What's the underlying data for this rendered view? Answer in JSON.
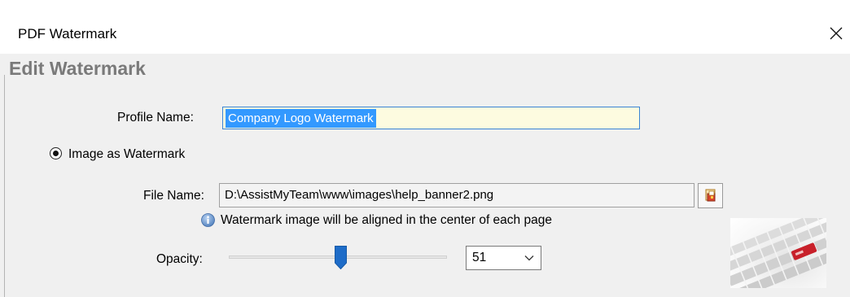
{
  "window": {
    "title": "PDF Watermark",
    "close_icon": "close-icon"
  },
  "heading": "Edit Watermark",
  "profile": {
    "label": "Profile Name:",
    "value": "Company Logo Watermark"
  },
  "watermark_type": {
    "image_option_label": "Image as Watermark",
    "image_option_selected": true
  },
  "file": {
    "label": "File Name:",
    "value": "D:\\AssistMyTeam\\www\\images\\help_banner2.png",
    "browse_icon": "browse-file-icon"
  },
  "info": {
    "icon": "info-icon",
    "text": "Watermark image will be aligned in the center of each page"
  },
  "opacity": {
    "label": "Opacity:",
    "value": "51",
    "slider_level": 0.51
  },
  "colors": {
    "accent": "#3a84d4",
    "heading": "#7a7a7a",
    "thumb": "#1e6cc8",
    "selection": "#3399ff"
  }
}
